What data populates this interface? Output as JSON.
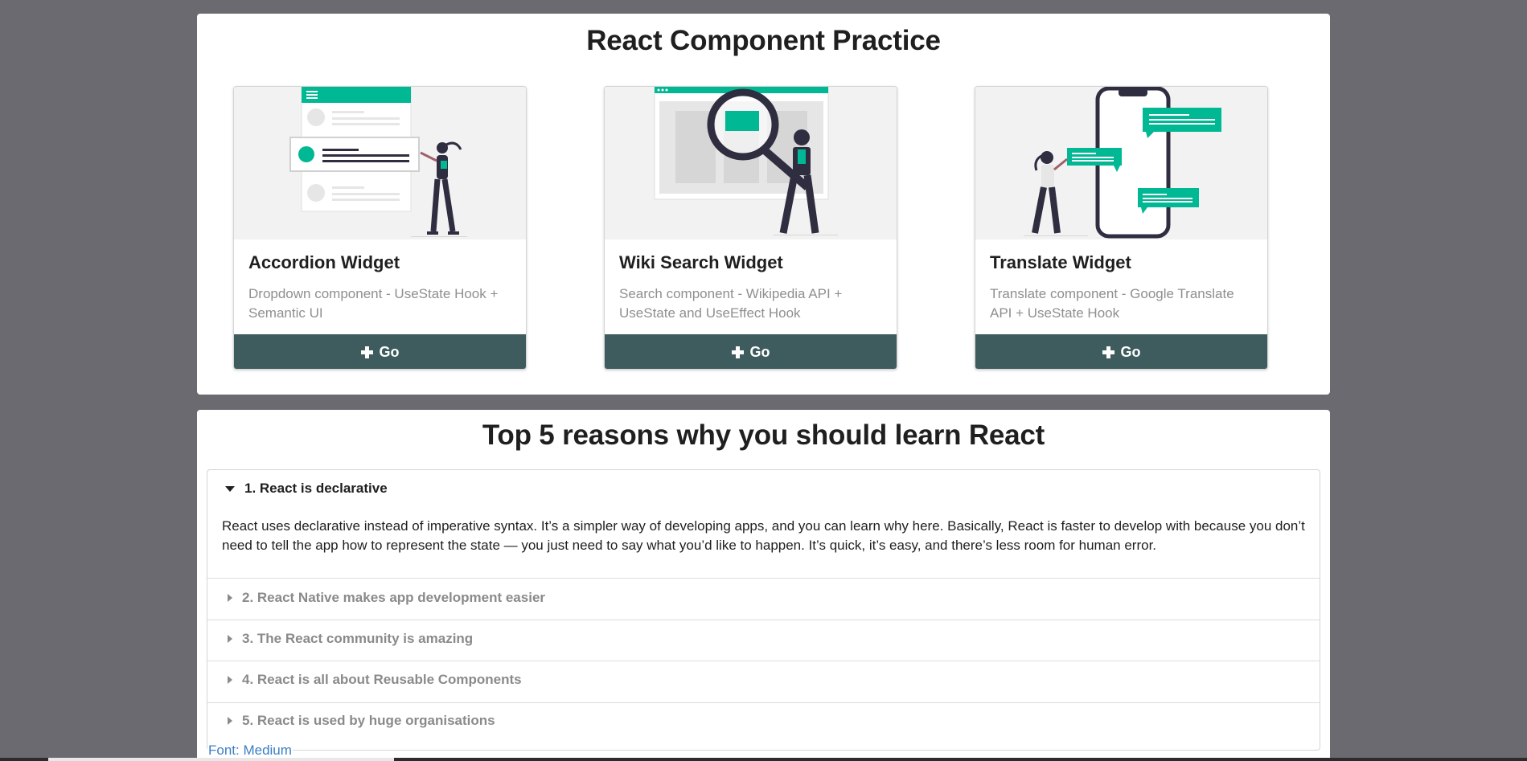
{
  "components_section": {
    "title": "React Component Practice",
    "cards": [
      {
        "header": "Accordion Widget",
        "description": "Dropdown component - UseState Hook + Semantic UI",
        "button_label": "Go"
      },
      {
        "header": "Wiki Search Widget",
        "description": "Search component - Wikipedia API + UseState and UseEffect Hook",
        "button_label": "Go"
      },
      {
        "header": "Translate Widget",
        "description": "Translate component - Google Translate API + UseState Hook",
        "button_label": "Go"
      }
    ]
  },
  "reasons_section": {
    "title": "Top 5 reasons why you should learn React",
    "items": [
      {
        "title": "1. React is declarative",
        "content": "React uses declarative instead of imperative syntax. It’s a simpler way of developing apps, and you can learn why here. Basically, React is faster to develop with because you don’t need to tell the app how to represent the state — you just need to say what you’d like to happen. It’s quick, it’s easy, and there’s less room for human error.",
        "expanded": true
      },
      {
        "title": "2. React Native makes app development easier",
        "expanded": false
      },
      {
        "title": "3. The React community is amazing",
        "expanded": false
      },
      {
        "title": "4. React is all about Reusable Components",
        "expanded": false
      },
      {
        "title": "5. React is used by huge organisations",
        "expanded": false
      }
    ]
  },
  "footer": {
    "font_link": "Font: Medium"
  },
  "colors": {
    "background": "#6b6a71",
    "accent": "#00b894",
    "button": "#3e5b5e",
    "link": "#3b7fc4"
  },
  "icons": {
    "button_icon": "plus-icon",
    "expanded_icon": "caret-down-icon",
    "collapsed_icon": "caret-right-icon"
  }
}
